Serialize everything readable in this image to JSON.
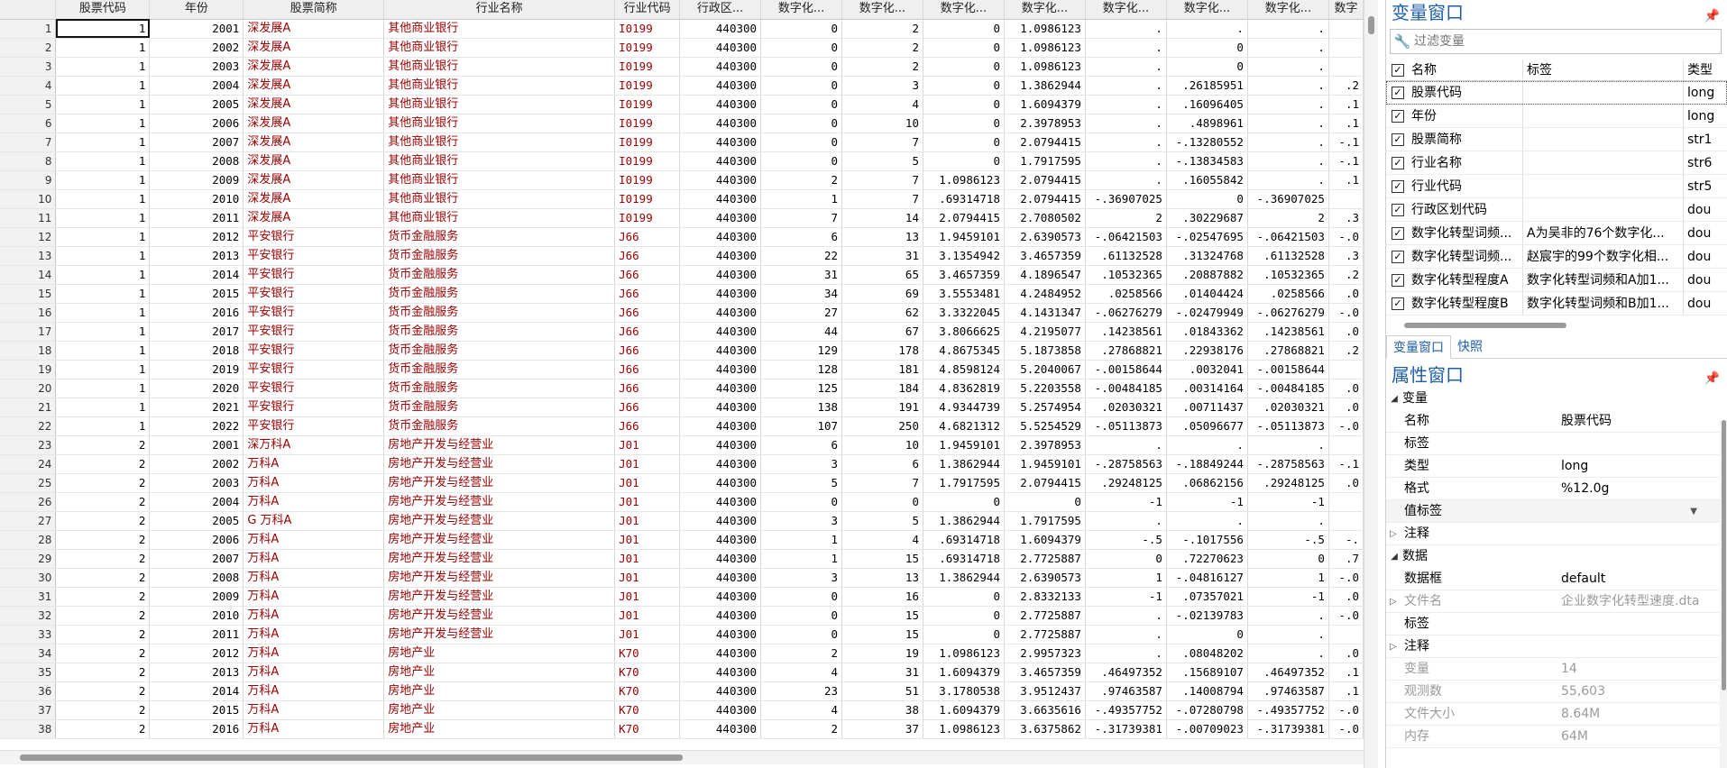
{
  "grid": {
    "columns": [
      "股票代码",
      "年份",
      "股票简称",
      "行业名称",
      "行业代码",
      "行政区...",
      "数字化...",
      "数字化...",
      "数字化...",
      "数字化...",
      "数字化...",
      "数字化...",
      "数字化...",
      "数字"
    ],
    "rows": [
      [
        "1",
        "1",
        "2001",
        "深发展A",
        "其他商业银行",
        "I0199",
        "440300",
        "0",
        "2",
        "0",
        "1.0986123",
        ".",
        ".",
        ".",
        ""
      ],
      [
        "2",
        "1",
        "2002",
        "深发展A",
        "其他商业银行",
        "I0199",
        "440300",
        "0",
        "2",
        "0",
        "1.0986123",
        ".",
        "0",
        ".",
        ""
      ],
      [
        "3",
        "1",
        "2003",
        "深发展A",
        "其他商业银行",
        "I0199",
        "440300",
        "0",
        "2",
        "0",
        "1.0986123",
        ".",
        "0",
        ".",
        ""
      ],
      [
        "4",
        "1",
        "2004",
        "深发展A",
        "其他商业银行",
        "I0199",
        "440300",
        "0",
        "3",
        "0",
        "1.3862944",
        ".",
        ".26185951",
        ".",
        ".2"
      ],
      [
        "5",
        "1",
        "2005",
        "深发展A",
        "其他商业银行",
        "I0199",
        "440300",
        "0",
        "4",
        "0",
        "1.6094379",
        ".",
        ".16096405",
        ".",
        ".1"
      ],
      [
        "6",
        "1",
        "2006",
        "深发展A",
        "其他商业银行",
        "I0199",
        "440300",
        "0",
        "10",
        "0",
        "2.3978953",
        ".",
        ".4898961",
        ".",
        ".1"
      ],
      [
        "7",
        "1",
        "2007",
        "深发展A",
        "其他商业银行",
        "I0199",
        "440300",
        "0",
        "7",
        "0",
        "2.0794415",
        ".",
        "-.13280552",
        ".",
        "-.1"
      ],
      [
        "8",
        "1",
        "2008",
        "深发展A",
        "其他商业银行",
        "I0199",
        "440300",
        "0",
        "5",
        "0",
        "1.7917595",
        ".",
        "-.13834583",
        ".",
        "-.1"
      ],
      [
        "9",
        "1",
        "2009",
        "深发展A",
        "其他商业银行",
        "I0199",
        "440300",
        "2",
        "7",
        "1.0986123",
        "2.0794415",
        ".",
        ".16055842",
        ".",
        ".1"
      ],
      [
        "10",
        "1",
        "2010",
        "深发展A",
        "其他商业银行",
        "I0199",
        "440300",
        "1",
        "7",
        ".69314718",
        "2.0794415",
        "-.36907025",
        "0",
        "-.36907025",
        ""
      ],
      [
        "11",
        "1",
        "2011",
        "深发展A",
        "其他商业银行",
        "I0199",
        "440300",
        "7",
        "14",
        "2.0794415",
        "2.7080502",
        "2",
        ".30229687",
        "2",
        ".3"
      ],
      [
        "12",
        "1",
        "2012",
        "平安银行",
        "货币金融服务",
        "J66",
        "440300",
        "6",
        "13",
        "1.9459101",
        "2.6390573",
        "-.06421503",
        "-.02547695",
        "-.06421503",
        "-.0"
      ],
      [
        "13",
        "1",
        "2013",
        "平安银行",
        "货币金融服务",
        "J66",
        "440300",
        "22",
        "31",
        "3.1354942",
        "3.4657359",
        ".61132528",
        ".31324768",
        ".61132528",
        ".3"
      ],
      [
        "14",
        "1",
        "2014",
        "平安银行",
        "货币金融服务",
        "J66",
        "440300",
        "31",
        "65",
        "3.4657359",
        "4.1896547",
        ".10532365",
        ".20887882",
        ".10532365",
        ".2"
      ],
      [
        "15",
        "1",
        "2015",
        "平安银行",
        "货币金融服务",
        "J66",
        "440300",
        "34",
        "69",
        "3.5553481",
        "4.2484952",
        ".0258566",
        ".01404424",
        ".0258566",
        ".0"
      ],
      [
        "16",
        "1",
        "2016",
        "平安银行",
        "货币金融服务",
        "J66",
        "440300",
        "27",
        "62",
        "3.3322045",
        "4.1431347",
        "-.06276279",
        "-.02479949",
        "-.06276279",
        "-.0"
      ],
      [
        "17",
        "1",
        "2017",
        "平安银行",
        "货币金融服务",
        "J66",
        "440300",
        "44",
        "67",
        "3.8066625",
        "4.2195077",
        ".14238561",
        ".01843362",
        ".14238561",
        ".0"
      ],
      [
        "18",
        "1",
        "2018",
        "平安银行",
        "货币金融服务",
        "J66",
        "440300",
        "129",
        "178",
        "4.8675345",
        "5.1873858",
        ".27868821",
        ".22938176",
        ".27868821",
        ".2"
      ],
      [
        "19",
        "1",
        "2019",
        "平安银行",
        "货币金融服务",
        "J66",
        "440300",
        "128",
        "181",
        "4.8598124",
        "5.2040067",
        "-.00158644",
        ".0032041",
        "-.00158644",
        ""
      ],
      [
        "20",
        "1",
        "2020",
        "平安银行",
        "货币金融服务",
        "J66",
        "440300",
        "125",
        "184",
        "4.8362819",
        "5.2203558",
        "-.00484185",
        ".00314164",
        "-.00484185",
        ".0"
      ],
      [
        "21",
        "1",
        "2021",
        "平安银行",
        "货币金融服务",
        "J66",
        "440300",
        "138",
        "191",
        "4.9344739",
        "5.2574954",
        ".02030321",
        ".00711437",
        ".02030321",
        ".0"
      ],
      [
        "22",
        "1",
        "2022",
        "平安银行",
        "货币金融服务",
        "J66",
        "440300",
        "107",
        "250",
        "4.6821312",
        "5.5254529",
        "-.05113873",
        ".05096677",
        "-.05113873",
        "-.0"
      ],
      [
        "23",
        "2",
        "2001",
        "深万科A",
        "房地产开发与经营业",
        "J01",
        "440300",
        "6",
        "10",
        "1.9459101",
        "2.3978953",
        ".",
        ".",
        ".",
        ""
      ],
      [
        "24",
        "2",
        "2002",
        "万科A",
        "房地产开发与经营业",
        "J01",
        "440300",
        "3",
        "6",
        "1.3862944",
        "1.9459101",
        "-.28758563",
        "-.18849244",
        "-.28758563",
        "-.1"
      ],
      [
        "25",
        "2",
        "2003",
        "万科A",
        "房地产开发与经营业",
        "J01",
        "440300",
        "5",
        "7",
        "1.7917595",
        "2.0794415",
        ".29248125",
        ".06862156",
        ".29248125",
        ".0"
      ],
      [
        "26",
        "2",
        "2004",
        "万科A",
        "房地产开发与经营业",
        "J01",
        "440300",
        "0",
        "0",
        "0",
        "0",
        "-1",
        "-1",
        "-1",
        ""
      ],
      [
        "27",
        "2",
        "2005",
        "G 万科A",
        "房地产开发与经营业",
        "J01",
        "440300",
        "3",
        "5",
        "1.3862944",
        "1.7917595",
        ".",
        ".",
        ".",
        ""
      ],
      [
        "28",
        "2",
        "2006",
        "万科A",
        "房地产开发与经营业",
        "J01",
        "440300",
        "1",
        "4",
        ".69314718",
        "1.6094379",
        "-.5",
        "-.1017556",
        "-.5",
        "-."
      ],
      [
        "29",
        "2",
        "2007",
        "万科A",
        "房地产开发与经营业",
        "J01",
        "440300",
        "1",
        "15",
        ".69314718",
        "2.7725887",
        "0",
        ".72270623",
        "0",
        ".7"
      ],
      [
        "30",
        "2",
        "2008",
        "万科A",
        "房地产开发与经营业",
        "J01",
        "440300",
        "3",
        "13",
        "1.3862944",
        "2.6390573",
        "1",
        "-.04816127",
        "1",
        "-.0"
      ],
      [
        "31",
        "2",
        "2009",
        "万科A",
        "房地产开发与经营业",
        "J01",
        "440300",
        "0",
        "16",
        "0",
        "2.8332133",
        "-1",
        ".07357021",
        "-1",
        ".0"
      ],
      [
        "32",
        "2",
        "2010",
        "万科A",
        "房地产开发与经营业",
        "J01",
        "440300",
        "0",
        "15",
        "0",
        "2.7725887",
        ".",
        "-.02139783",
        ".",
        "-.0"
      ],
      [
        "33",
        "2",
        "2011",
        "万科A",
        "房地产开发与经营业",
        "J01",
        "440300",
        "0",
        "15",
        "0",
        "2.7725887",
        ".",
        "0",
        ".",
        ""
      ],
      [
        "34",
        "2",
        "2012",
        "万科A",
        "房地产业",
        "K70",
        "440300",
        "2",
        "19",
        "1.0986123",
        "2.9957323",
        ".",
        ".08048202",
        ".",
        ".0"
      ],
      [
        "35",
        "2",
        "2013",
        "万科A",
        "房地产业",
        "K70",
        "440300",
        "4",
        "31",
        "1.6094379",
        "3.4657359",
        ".46497352",
        ".15689107",
        ".46497352",
        ".1"
      ],
      [
        "36",
        "2",
        "2014",
        "万科A",
        "房地产业",
        "K70",
        "440300",
        "23",
        "51",
        "3.1780538",
        "3.9512437",
        ".97463587",
        ".14008794",
        ".97463587",
        ".1"
      ],
      [
        "37",
        "2",
        "2015",
        "万科A",
        "房地产业",
        "K70",
        "440300",
        "4",
        "38",
        "1.6094379",
        "3.6635616",
        "-.49357752",
        "-.07280798",
        "-.49357752",
        "-.0"
      ],
      [
        "38",
        "2",
        "2016",
        "万科A",
        "房地产业",
        "K70",
        "440300",
        "2",
        "37",
        "1.0986123",
        "3.6375862",
        "-.31739381",
        "-.00709023",
        "-.31739381",
        "-.0"
      ]
    ]
  },
  "variables_window": {
    "title": "变量窗口",
    "filter_placeholder": "过滤变量",
    "headers": {
      "name": "名称",
      "label": "标签",
      "type": "类型"
    },
    "items": [
      {
        "name": "股票代码",
        "label": "",
        "type": "long"
      },
      {
        "name": "年份",
        "label": "",
        "type": "long"
      },
      {
        "name": "股票简称",
        "label": "",
        "type": "str1"
      },
      {
        "name": "行业名称",
        "label": "",
        "type": "str6"
      },
      {
        "name": "行业代码",
        "label": "",
        "type": "str5"
      },
      {
        "name": "行政区划代码",
        "label": "",
        "type": "dou"
      },
      {
        "name": "数字化转型词频...",
        "label": "A为吴非的76个数字化...",
        "type": "dou"
      },
      {
        "name": "数字化转型词频...",
        "label": "赵宸宇的99个数字化相...",
        "type": "dou"
      },
      {
        "name": "数字化转型程度A",
        "label": "数字化转型词频和A加1...",
        "type": "dou"
      },
      {
        "name": "数字化转型程度B",
        "label": "数字化转型词频和B加1...",
        "type": "dou"
      }
    ]
  },
  "tabs": {
    "variables": "变量窗口",
    "snapshot": "快照"
  },
  "properties_window": {
    "title": "属性窗口",
    "section_variable": "变量",
    "var_props": [
      {
        "key": "名称",
        "value": "股票代码"
      },
      {
        "key": "标签",
        "value": ""
      },
      {
        "key": "类型",
        "value": "long"
      },
      {
        "key": "格式",
        "value": "%12.0g"
      },
      {
        "key": "值标签",
        "value": ""
      },
      {
        "key": "注释",
        "value": ""
      }
    ],
    "section_data": "数据",
    "data_props": [
      {
        "key": "数据框",
        "value": "default"
      },
      {
        "key": "文件名",
        "value": "企业数字化转型速度.dta"
      },
      {
        "key": "标签",
        "value": ""
      },
      {
        "key": "注释",
        "value": ""
      },
      {
        "key": "变量",
        "value": "14"
      },
      {
        "key": "观测数",
        "value": "55,603"
      },
      {
        "key": "文件大小",
        "value": "8.64M"
      },
      {
        "key": "内存",
        "value": "64M"
      }
    ]
  },
  "icons": {
    "pin": "pin-icon",
    "wrench": "wrench-icon",
    "check": "check-icon"
  }
}
